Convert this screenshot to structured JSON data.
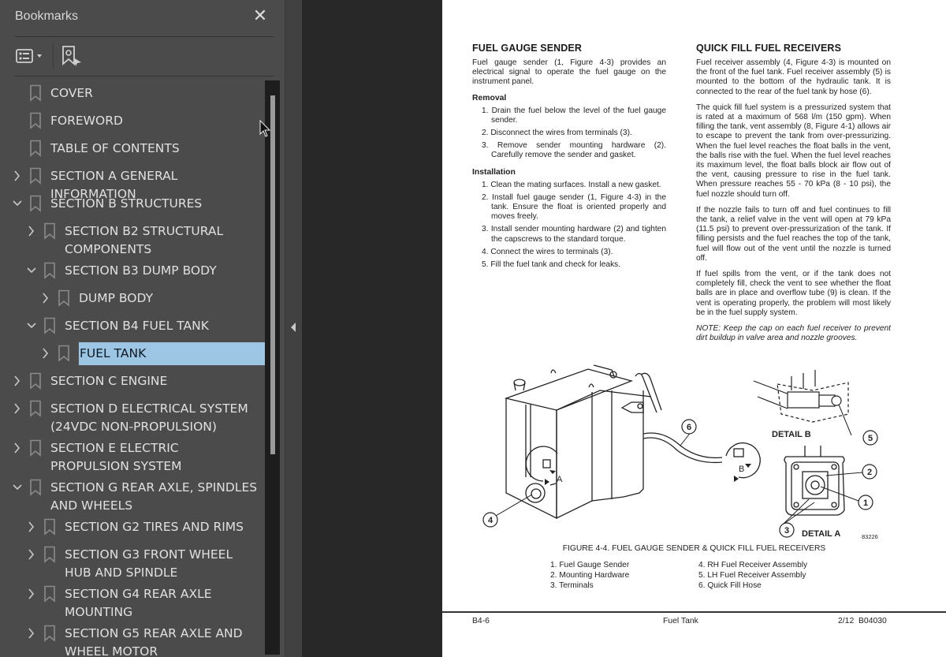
{
  "sidebar": {
    "title": "Bookmarks",
    "close_icon": "close-icon",
    "toolbar": {
      "options_icon": "list-options-icon",
      "new_bookmark_icon": "new-bookmark-icon"
    },
    "items": [
      {
        "label": "COVER",
        "level": 0,
        "expander": "none"
      },
      {
        "label": "FOREWORD",
        "level": 0,
        "expander": "none"
      },
      {
        "label": "TABLE OF CONTENTS",
        "level": 0,
        "expander": "none"
      },
      {
        "label": "SECTION A GENERAL INFORMATION",
        "level": 0,
        "expander": "collapsed"
      },
      {
        "label": "SECTION B STRUCTURES",
        "level": 0,
        "expander": "expanded"
      },
      {
        "label": "SECTION B2 STRUCTURAL COMPONENTS",
        "level": 1,
        "expander": "collapsed"
      },
      {
        "label": "SECTION B3 DUMP BODY",
        "level": 1,
        "expander": "expanded"
      },
      {
        "label": "DUMP BODY",
        "level": 2,
        "expander": "collapsed"
      },
      {
        "label": "SECTION B4 FUEL TANK",
        "level": 1,
        "expander": "expanded"
      },
      {
        "label": "FUEL TANK",
        "level": 2,
        "expander": "collapsed",
        "selected": true
      },
      {
        "label": "SECTION C ENGINE",
        "level": 0,
        "expander": "collapsed"
      },
      {
        "label": "SECTION D ELECTRICAL SYSTEM (24VDC NON-PROPULSION)",
        "level": 0,
        "expander": "collapsed"
      },
      {
        "label": "SECTION E ELECTRIC PROPULSION SYSTEM",
        "level": 0,
        "expander": "collapsed"
      },
      {
        "label": "SECTION G REAR AXLE, SPINDLES AND WHEELS",
        "level": 0,
        "expander": "expanded"
      },
      {
        "label": "SECTION G2 TIRES AND RIMS",
        "level": 1,
        "expander": "collapsed"
      },
      {
        "label": "SECTION G3 FRONT WHEEL HUB AND SPINDLE",
        "level": 1,
        "expander": "collapsed"
      },
      {
        "label": "SECTION G4 REAR AXLE MOUNTING",
        "level": 1,
        "expander": "collapsed"
      },
      {
        "label": "SECTION G5 REAR AXLE AND WHEEL MOTOR",
        "level": 1,
        "expander": "collapsed"
      }
    ],
    "selection_color": "#9cc6e3"
  },
  "page": {
    "left": {
      "heading": "FUEL GAUGE SENDER",
      "intro": "Fuel gauge sender (1, Figure 4-3) provides an electrical signal to operate the fuel gauge on the instrument panel.",
      "removal_heading": "Removal",
      "removal_steps": [
        "1. Drain the fuel below the level of the fuel gauge sender.",
        "2. Disconnect the wires from terminals (3).",
        "3. Remove sender mounting hardware (2). Carefully remove the sender and gasket."
      ],
      "installation_heading": "Installation",
      "installation_steps": [
        "1. Clean the mating surfaces. Install a new gasket.",
        "2. Install fuel gauge sender (1, Figure 4-3) in the tank. Ensure the float is oriented properly and moves freely.",
        "3. Install sender mounting hardware (2) and tighten the capscrews to the standard torque.",
        "4. Connect the wires to terminals (3).",
        "5. Fill the fuel tank and check for leaks."
      ]
    },
    "right": {
      "heading": "QUICK FILL FUEL RECEIVERS",
      "paragraphs": [
        "Fuel receiver assembly (4, Figure 4-3) is mounted on the front of the fuel tank. Fuel receiver assembly (5) is mounted to the bottom of the hydraulic tank. It is connected to the rear of the fuel tank by hose (6).",
        "The quick fill fuel system is a pressurized system that is rated at a maximum of 568 l/m (150 gpm). When filling the tank, vent assembly (8, Figure 4-1) allows air to escape to prevent the tank from over-pressurizing. When the fuel level reaches the float balls in the vent, the balls rise with the fuel. When the fuel level reaches its maximum level, the float balls block air flow out of the vent, causing pressure to rise in the fuel tank. When pressure reaches 55 - 70 kPa (8 - 10 psi), the fuel nozzle should turn off.",
        "If the nozzle fails to turn off and fuel continues to fill the tank, a relief valve in the vent will open at 79 kPa (11.5 psi) to prevent over-pressurization of the tank. If filling persists and the fuel reaches the top of the tank, fuel will flow out of the vent until the nozzle is turned off.",
        "If fuel spills from the vent, or if the tank does not completely fill, check the vent to see whether the float balls are in place and overflow tube (9) is clean. If the vent is operating properly, the problem will most likely be in the fuel supply system."
      ],
      "note": "NOTE: Keep the cap on each fuel receiver to prevent dirt buildup in valve area and nozzle grooves."
    },
    "figure": {
      "callouts": [
        "1",
        "2",
        "3",
        "4",
        "5",
        "6"
      ],
      "view_labels": {
        "a": "A",
        "b": "B"
      },
      "detail_a": "DETAIL A",
      "detail_b": "DETAIL B",
      "drawing_number": "83226",
      "caption": "FIGURE 4-4. FUEL GAUGE SENDER & QUICK FILL FUEL RECEIVERS",
      "legend_left": [
        "1. Fuel Gauge Sender",
        "2. Mounting Hardware",
        "3. Terminals"
      ],
      "legend_right": [
        "4. RH Fuel Receiver Assembly",
        "5. LH Fuel Receiver Assembly",
        "6. Quick Fill Hose"
      ]
    },
    "footer": {
      "page_number": "B4-6",
      "section": "Fuel Tank",
      "revision": "2/12  B04030"
    }
  }
}
